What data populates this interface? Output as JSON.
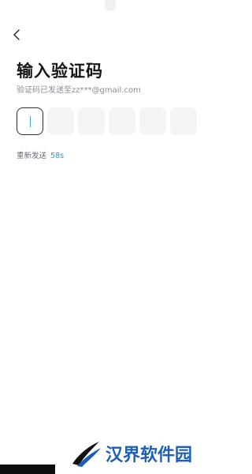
{
  "header": {
    "back_icon": "chevron-left-icon",
    "title": "输入验证码",
    "subtitle": "验证码已发送至zz***@gmail.com"
  },
  "code_input": {
    "length": 6,
    "active_index": 0,
    "values": [
      "",
      "",
      "",
      "",
      "",
      ""
    ]
  },
  "resend": {
    "label": "重新发送",
    "countdown": "58s"
  },
  "watermark": {
    "text": "汉界软件园",
    "logo_icon": "swoosh-logo-icon"
  },
  "colors": {
    "accent": "#2f9ad8",
    "box_fill": "#f3f4f6",
    "active_border": "#2a2c30",
    "watermark": "#1d5fb8"
  }
}
